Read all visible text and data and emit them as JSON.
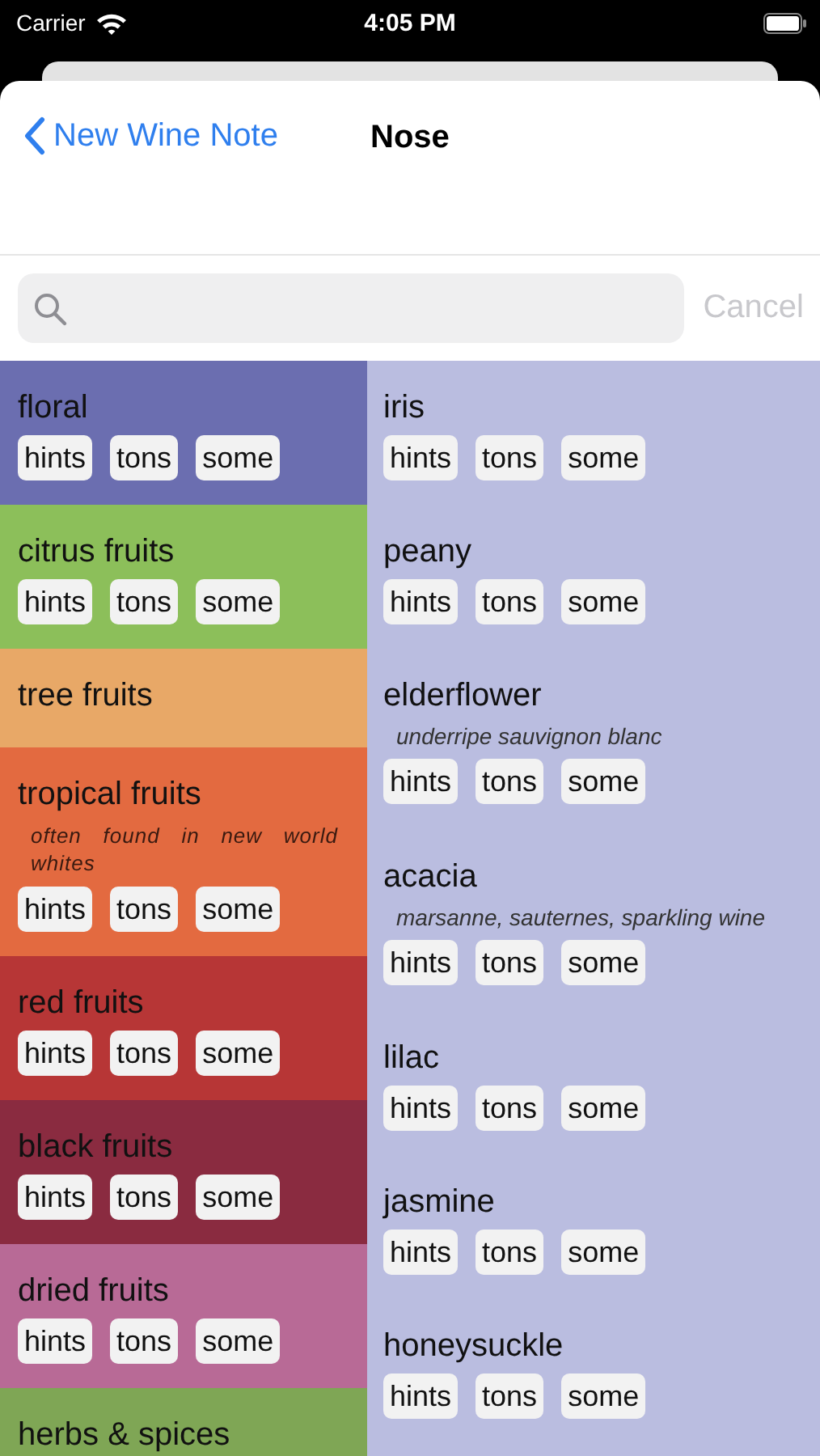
{
  "status_bar": {
    "carrier": "Carrier",
    "time": "4:05 PM"
  },
  "nav": {
    "back": "New Wine Note",
    "title": "Nose"
  },
  "search": {
    "cancel": "Cancel"
  },
  "categories": [
    {
      "name": "floral",
      "color": "#6b6eb0",
      "chips": [
        "hints",
        "tons",
        "some"
      ]
    },
    {
      "name": "citrus fruits",
      "color": "#8cbf5a",
      "chips": [
        "hints",
        "tons",
        "some"
      ]
    },
    {
      "name": "tree fruits",
      "color": "#e8a867"
    },
    {
      "name": "tropical fruits",
      "color": "#e36a40",
      "note": "often found in new world whites",
      "chips": [
        "hints",
        "tons",
        "some"
      ]
    },
    {
      "name": "red fruits",
      "color": "#b73636",
      "chips": [
        "hints",
        "tons",
        "some"
      ]
    },
    {
      "name": "black fruits",
      "color": "#8a2b40",
      "chips": [
        "hints",
        "tons",
        "some"
      ]
    },
    {
      "name": "dried fruits",
      "color": "#b86a96",
      "chips": [
        "hints",
        "tons",
        "some"
      ]
    },
    {
      "name": "herbs & spices",
      "color": "#7fa655"
    }
  ],
  "aromas": [
    {
      "name": "iris",
      "chips": [
        "hints",
        "tons",
        "some"
      ]
    },
    {
      "name": "peany",
      "chips": [
        "hints",
        "tons",
        "some"
      ]
    },
    {
      "name": "elderflower",
      "note": "underripe sauvignon blanc",
      "chips": [
        "hints",
        "tons",
        "some"
      ]
    },
    {
      "name": "acacia",
      "note": "marsanne, sauternes, sparkling wine",
      "chips": [
        "hints",
        "tons",
        "some"
      ]
    },
    {
      "name": "lilac",
      "chips": [
        "hints",
        "tons",
        "some"
      ]
    },
    {
      "name": "jasmine",
      "chips": [
        "hints",
        "tons",
        "some"
      ]
    },
    {
      "name": "honeysuckle",
      "chips": [
        "hints",
        "tons",
        "some"
      ]
    }
  ]
}
